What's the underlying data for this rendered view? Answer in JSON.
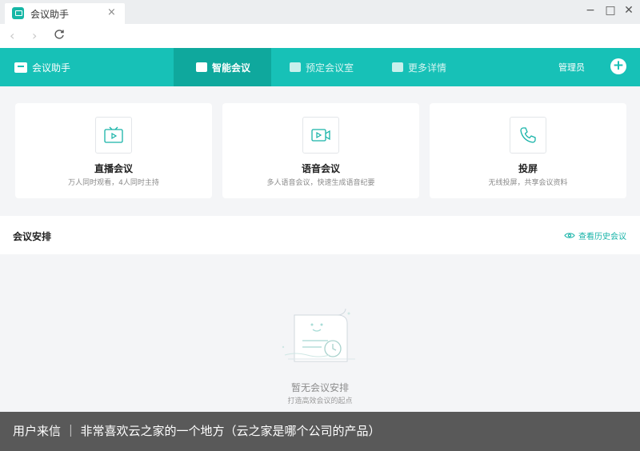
{
  "window": {
    "tab_title": "会议助手",
    "tab_close": "×",
    "controls": {
      "minimize": "−",
      "maximize": "□",
      "close": "✕"
    }
  },
  "nav": {
    "back": "‹",
    "forward": "›"
  },
  "header": {
    "brand": "会议助手",
    "tabs": [
      {
        "label": "智能会议",
        "active": true,
        "icon": "chat-icon"
      },
      {
        "label": "预定会议室",
        "active": false,
        "icon": "book-icon"
      },
      {
        "label": "更多详情",
        "active": false,
        "icon": "grid-icon"
      }
    ],
    "admin": "管理员",
    "add": "+"
  },
  "cards": [
    {
      "title": "直播会议",
      "desc": "万人同时观看，4人同时主持",
      "icon": "tv-play-icon"
    },
    {
      "title": "语音会议",
      "desc": "多人语音会议，快速生成语音纪要",
      "icon": "video-camera-icon"
    },
    {
      "title": "投屏",
      "desc": "无线投屏，共享会议资料",
      "icon": "phone-icon"
    }
  ],
  "schedule": {
    "title": "会议安排",
    "history": "查看历史会议",
    "empty_title": "暂无会议安排",
    "empty_sub": "打造高效会议的起点"
  },
  "caption": "用户来信 ｜ 非常喜欢云之家的一个地方（云之家是哪个公司的产品）",
  "colors": {
    "accent": "#17c1b7",
    "accent_dark": "#0fa89d",
    "bg": "#f4f5f7"
  }
}
